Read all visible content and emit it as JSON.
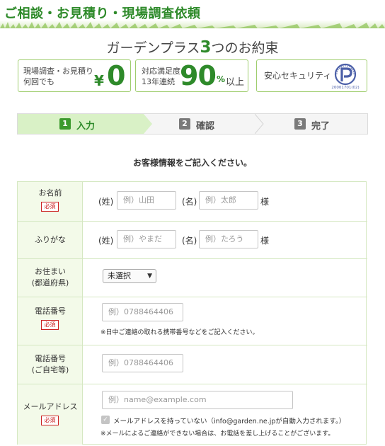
{
  "header": {
    "title": "ご相談・お見積り・現場調査依頼"
  },
  "promise": {
    "title_prefix": "ガーデンプラス",
    "title_num": "3",
    "title_suffix": "つのお約束",
    "box1": {
      "line1": "現場調査・お見積り",
      "line2": "何回でも",
      "yen": "¥",
      "value": "0"
    },
    "box2": {
      "line1": "対応満足度",
      "line2": "13年連続",
      "value": "90",
      "pct": "%",
      "suffix": "以上"
    },
    "box3": {
      "label": "安心セキュリティ",
      "mark_text": "20001701(02)"
    }
  },
  "steps": [
    {
      "num": "1",
      "label": "入力",
      "active": true
    },
    {
      "num": "2",
      "label": "確認",
      "active": false
    },
    {
      "num": "3",
      "label": "完了",
      "active": false
    }
  ],
  "form": {
    "title": "お客様情報をご記入ください。",
    "required_label": "必須",
    "name": {
      "label": "お名前",
      "sei": "(姓)",
      "sei_placeholder": "例）山田",
      "mei": "(名)",
      "mei_placeholder": "例）太郎",
      "sama": "様"
    },
    "furigana": {
      "label": "ふりがな",
      "sei": "(姓)",
      "sei_placeholder": "例）やまだ",
      "mei": "(名)",
      "mei_placeholder": "例）たろう",
      "sama": "様"
    },
    "address": {
      "label1": "お住まい",
      "label2": "(都道府県)",
      "select_value": "未選択"
    },
    "phone": {
      "label": "電話番号",
      "placeholder": "例）0788464406",
      "note": "※日中ご連絡の取れる携帯番号などをご記入ください。"
    },
    "home_phone": {
      "label1": "電話番号",
      "label2": "(ご自宅等)",
      "placeholder": "例）0788464406"
    },
    "email": {
      "label": "メールアドレス",
      "placeholder": "例）name@example.com",
      "checkbox_label": "メールアドレスを持っていない（info@garden.ne.jpが自動入力されます。）",
      "note": "※メールによるご連絡ができない場合は、お電話を差し上げることがございます。"
    }
  }
}
